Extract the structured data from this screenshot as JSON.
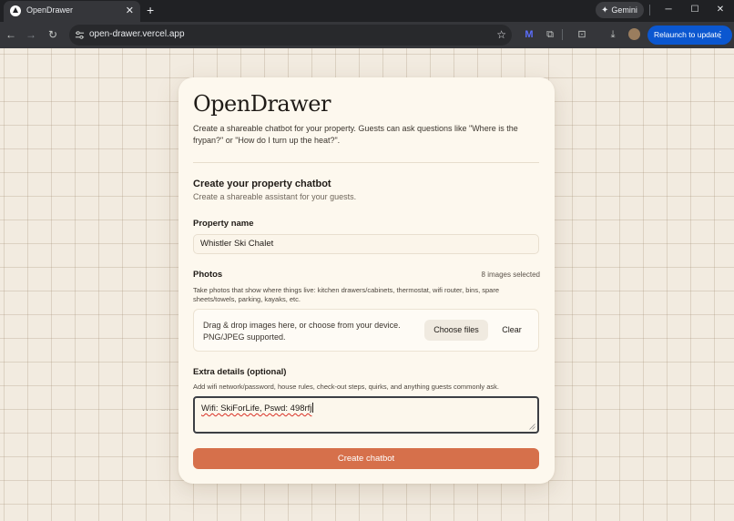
{
  "browser": {
    "tab_title": "OpenDrawer",
    "tab_close": "✕",
    "new_tab": "+",
    "gemini_label": "Gemini",
    "url": "open-drawer.vercel.app",
    "relaunch_label": "Relaunch to update",
    "accent_color": "#0b57d0"
  },
  "app": {
    "brand": "OpenDrawer",
    "intro": "Create a shareable chatbot for your property. Guests can ask questions like \"Where is the frypan?\" or \"How do I turn up the heat?\".",
    "section_title": "Create your property chatbot",
    "section_subtitle": "Create a shareable assistant for your guests.",
    "property_name": {
      "label": "Property name",
      "value": "Whistler Ski Chalet"
    },
    "photos": {
      "label": "Photos",
      "count_text": "8 images selected",
      "help": "Take photos that show where things live: kitchen drawers/cabinets, thermostat, wifi router, bins, spare sheets/towels, parking, kayaks, etc.",
      "dropzone_line1": "Drag & drop images here, or choose from your device.",
      "dropzone_line2": "PNG/JPEG supported.",
      "choose_label": "Choose files",
      "clear_label": "Clear"
    },
    "extra": {
      "label": "Extra details (optional)",
      "help": "Add wifi network/password, house rules, check-out steps, quirks, and anything guests commonly ask.",
      "value": "Wifi: SkiForLife, Pswd: 498rfj"
    },
    "submit_label": "Create chatbot",
    "button_color": "#d6704b"
  }
}
